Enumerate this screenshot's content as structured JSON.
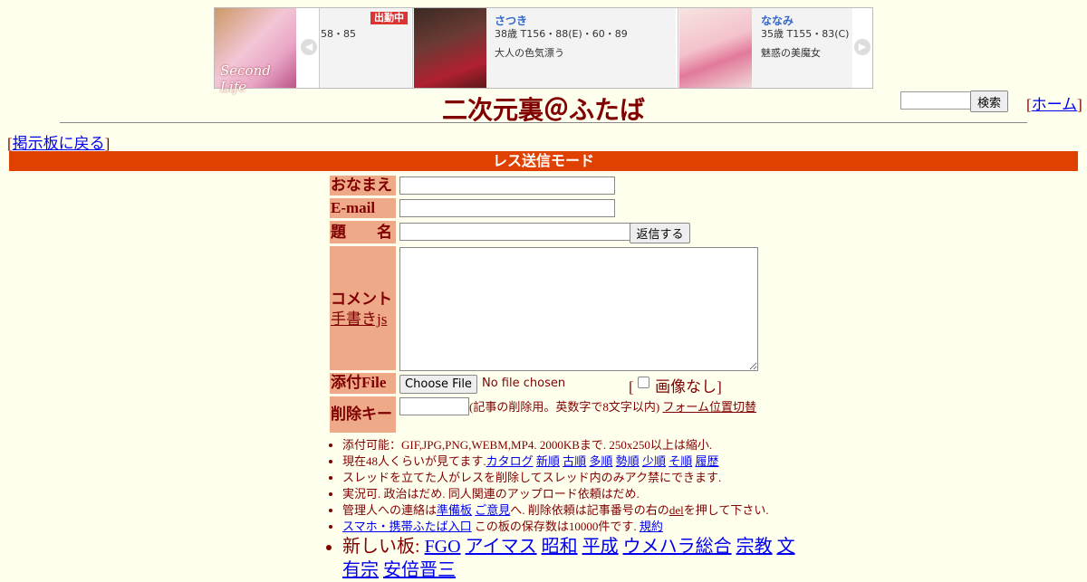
{
  "ad": {
    "logo_text": "Second Life",
    "badge": "出勤中",
    "slots": [
      {
        "name": "",
        "stats": "58・85",
        "desc": ""
      },
      {
        "name": "さつき",
        "stats": "38歳 T156・88(E)・60・89",
        "desc": "大人の色気漂う"
      },
      {
        "name": "ななみ",
        "stats": "35歳 T155・83(C)・",
        "desc": "魅惑の美魔女"
      }
    ],
    "arrow_left": "◀",
    "arrow_right": "▶"
  },
  "header": {
    "title": "二次元裏＠ふたば",
    "search_button": "検索",
    "home_open": "[",
    "home_link": "ホーム",
    "home_close": "]",
    "back_open": "[",
    "back_link": "掲示板に戻る",
    "back_close": "]"
  },
  "mode_bar": "レス送信モード",
  "form": {
    "name_label": "おなまえ",
    "email_label": "E-mail",
    "subject_label": "題　　名",
    "submit_button": "返信する",
    "comment_label": "コメント",
    "handwrite_link": "手書きjs",
    "file_label": "添付File",
    "file_button": "Choose File",
    "file_status": "No file chosen",
    "noimage_open": "[",
    "noimage_label": "画像なし",
    "noimage_close": "]",
    "delete_label": "削除キー",
    "delete_note": "(記事の削除用。英数字で8文字以内)",
    "form_position_link": "フォーム位置切替"
  },
  "notes": {
    "n1": "添付可能：GIF,JPG,PNG,WEBM,MP4. 2000KBまで. 250x250以上は縮小.",
    "n2_prefix": "現在48人くらいが見てます.",
    "n2_links": [
      "カタログ",
      "新順",
      "古順",
      "多順",
      "勢順",
      "少順",
      "そ順",
      "履歴"
    ],
    "n3": "スレッドを立てた人がレスを削除してスレッド内のみアク禁にできます.",
    "n4": "実況可. 政治はだめ. 同人関連のアップロード依頼はだめ.",
    "n5_a": "管理人への連絡は",
    "n5_link1": "準備板",
    "n5_link2": "ご意見",
    "n5_b": "へ. 削除依頼は記事番号の右の",
    "n5_del": "del",
    "n5_c": "を押して下さい.",
    "n6_link": "スマホ・携帯ふたば入口",
    "n6_text": " この板の保存数は10000件です.",
    "n6_rules": "規約",
    "n7_prefix": "新しい板:",
    "n7_links": [
      "FGO",
      "アイマス",
      "昭和",
      "平成",
      "ウメハラ総合",
      "宗教",
      "文有宗",
      "安倍晋三"
    ]
  }
}
